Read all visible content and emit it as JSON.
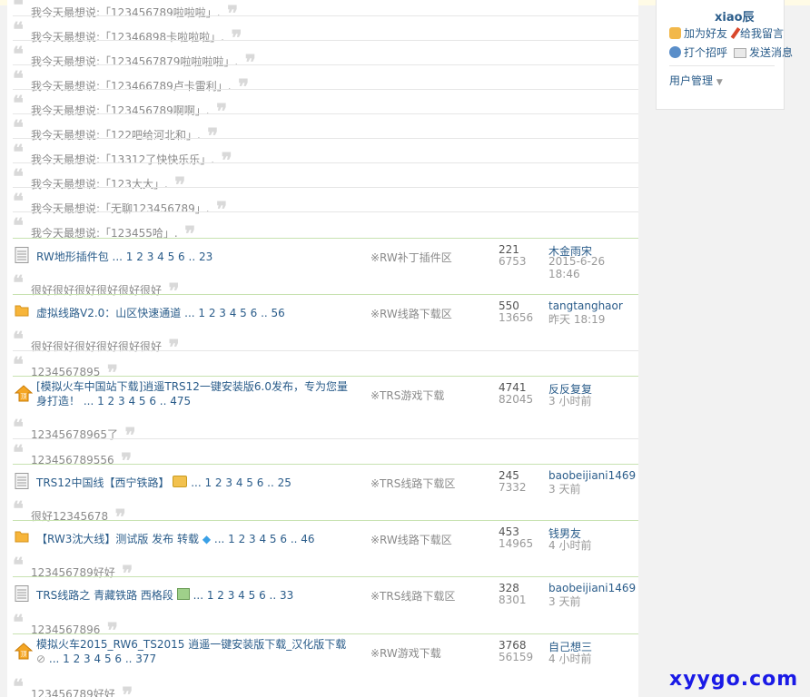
{
  "quotes_top": [
    "我今天最想说:「123456789啦啦啦」.",
    "我今天最想说:「12346898卡啦啦啦」.",
    "我今天最想说:「1234567879啦啦啦啦」.",
    "我今天最想说:「123466789卢卡雷利」.",
    "我今天最想说:「123456789啊啊」.",
    "我今天最想说:「122吧给河北和」.",
    "我今天最想说:「13312了快快乐乐」.",
    "我今天最想说:「123大大」.",
    "我今天最想说:「无聊123456789」.",
    "我今天最想说:「123455哈」."
  ],
  "threads": [
    {
      "title": "RW地形插件包",
      "pages": "... 1 2 3 4 5 6 .. 23",
      "forum": "※RW补丁插件区",
      "replies": "221",
      "views": "6753",
      "author": "木金雨宋",
      "time": "2015-6-26 18:46",
      "icon": "doc"
    },
    {
      "title": "虚拟线路V2.0：山区快速通道",
      "pages": "... 1 2 3 4 5 6 .. 56",
      "forum": "※RW线路下载区",
      "replies": "550",
      "views": "13656",
      "author": "tangtanghaor",
      "time": "昨天 18:19",
      "icon": "folder"
    },
    {
      "title": "[模拟火车中国站下载]逍遥TRS12一键安装版6.0发布，专为您量身打造！",
      "pages": "... 1 2 3 4 5 6 .. 475",
      "forum": "※TRS游戏下载",
      "replies": "4741",
      "views": "82045",
      "author": "反反复复",
      "time": "3 小时前",
      "icon": "top"
    },
    {
      "title": "TRS12中国线【西宁铁路】",
      "pages": "... 1 2 3 4 5 6 .. 25",
      "forum": "※TRS线路下载区",
      "replies": "245",
      "views": "7332",
      "author": "baobeijiani1469",
      "time": "3 天前",
      "icon": "doc"
    },
    {
      "title": "【RW3沈大线】测试版 发布 转载",
      "pages": "... 1 2 3 4 5 6 .. 46",
      "forum": "※RW线路下载区",
      "replies": "453",
      "views": "14965",
      "author": "钱男友",
      "time": "4 小时前",
      "icon": "folder"
    },
    {
      "title": "TRS线路之 青藏铁路 西格段",
      "pages": "... 1 2 3 4 5 6 .. 33",
      "forum": "※TRS线路下载区",
      "replies": "328",
      "views": "8301",
      "author": "baobeijiani1469",
      "time": "3 天前",
      "icon": "doc"
    },
    {
      "title": "模拟火车2015_RW6_TS2015 逍遥一键安装版下载_汉化版下载",
      "pages": "... 1 2 3 4 5 6 .. 377",
      "forum": "※RW游戏下载",
      "replies": "3768",
      "views": "56159",
      "author": "自己想三",
      "time": "4 小时前",
      "icon": "top"
    }
  ],
  "quotes": {
    "q1": "很好很好很好很好很好很好",
    "q2": "很好很好很好很好很好很好",
    "q3": "1234567895",
    "q4": "12345678965了",
    "q5": "123456789556",
    "q6": "很好12345678",
    "q7": "123456789好好",
    "q8": "1234567896",
    "q9": "123456789好好"
  },
  "sidebar": {
    "username": "xiao辰",
    "add_friend": "加为好友",
    "leave_msg": "给我留言",
    "greet": "打个招呼",
    "send_msg": "发送消息",
    "user_mgmt": "用户管理"
  },
  "watermark": "xyygo.com",
  "colors": {
    "link": "#2a5c8a",
    "quote_text": "#8a8a8a",
    "green_sep": "#c8e2b1"
  }
}
